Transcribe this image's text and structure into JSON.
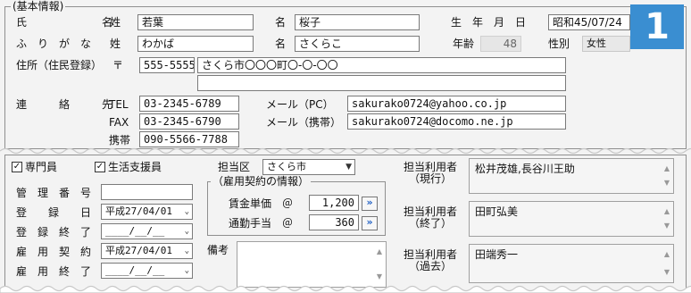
{
  "basic_section": {
    "legend": "(基本情報)",
    "name_label": "氏　　　名",
    "furigana_label": "ふ　り　が　な",
    "sei_label": "姓",
    "mei_label": "名",
    "last_name": "若葉",
    "first_name": "桜子",
    "last_name_kana": "わかば",
    "first_name_kana": "さくらこ",
    "birthday_label": "生　年　月　日",
    "birthday": "昭和45/07/24",
    "age_label": "年齢",
    "age": "48",
    "gender_label": "性別",
    "gender": "女性",
    "address_label": "住所（住民登録）",
    "postal_mark": "〒",
    "postal_code": "555-5555",
    "address1": "さくら市〇〇〇町〇-〇-〇〇",
    "address2": "",
    "contact_label": "連　絡　先",
    "tel_label": "TEL",
    "tel": "03-2345-6789",
    "fax_label": "FAX",
    "fax": "03-2345-6790",
    "mobile_label": "携帯",
    "mobile": "090-5566-7788",
    "email_pc_label": "メール（PC）",
    "email_pc": "sakurako0724@yahoo.co.jp",
    "email_mobile_label": "メール（携帯）",
    "email_mobile": "sakurako0724@docomo.ne.jp",
    "badge": "1"
  },
  "staff_section": {
    "specialist_label": "専門員",
    "specialist_checked": true,
    "support_label": "生活支援員",
    "support_checked": true,
    "area_label": "担当区",
    "area_value": "さくら市",
    "mgmt_no_label": "管　理　番　号",
    "mgmt_no": "",
    "reg_label": "登　　録　　日",
    "reg_date": "平成27/04/01",
    "reg_end_label": "登　録　終　了　日",
    "reg_end_date": "____/__/__",
    "hire_label": "雇　用　契　約　日",
    "hire_date": "平成27/04/01",
    "hire_end_label": "雇　用　終　了　日",
    "hire_end_date": "____/__/__",
    "contract_legend": "（雇用契約の情報）",
    "wage_label": "賃金単価　＠",
    "wage": "1,200",
    "commute_label": "通勤手当　＠",
    "commute": "360",
    "notes_label": "備考",
    "notes": "",
    "current_users_label": "担当利用者\n（現行）",
    "current_users": "松井茂雄,長谷川王助",
    "ended_users_label": "担当利用者\n（終了）",
    "ended_users": "田町弘美",
    "past_users_label": "担当利用者\n（過去）",
    "past_users": "田端秀一"
  },
  "icons": [
    "check-icon",
    "chevron-down-icon",
    "double-arrow-right-icon",
    "scroll-up-icon",
    "scroll-down-icon"
  ],
  "colors": {
    "badge": "#3a8ed1",
    "background": "#f3f3f3",
    "arrow": "#1f5fc4"
  }
}
